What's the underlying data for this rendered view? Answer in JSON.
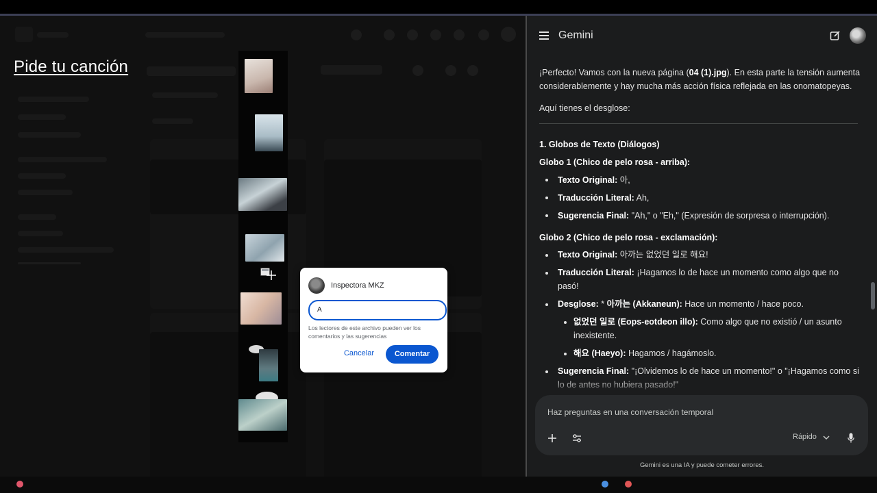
{
  "overlay": {
    "title": "Pide tu canción"
  },
  "comment_dialog": {
    "user_name": "Inspectora MKZ",
    "input_value": "A",
    "note": "Los lectores de este archivo pueden ver los comentarios y las sugerencias",
    "cancel_label": "Cancelar",
    "submit_label": "Comentar"
  },
  "gemini": {
    "title": "Gemini",
    "intro_1": "¡Perfecto! Vamos con la nueva página (",
    "intro_file": "04 (1).jpg",
    "intro_2": "). En esta parte la tensión aumenta considerablemente y hay mucha más acción física reflejada en las onomatopeyas.",
    "breakdown_intro": "Aquí tienes el desglose:",
    "section_heading": "1. Globos de Texto (Diálogos)",
    "globo1": {
      "heading": "Globo 1 (Chico de pelo rosa - arriba):",
      "original_label": "Texto Original:",
      "original_value": " 아,",
      "literal_label": "Traducción Literal:",
      "literal_value": " Ah,",
      "final_label": "Sugerencia Final:",
      "final_value": " \"Ah,\" o \"Eh,\" (Expresión de sorpresa o interrupción)."
    },
    "globo2": {
      "heading": "Globo 2 (Chico de pelo rosa - exclamación):",
      "original_label": "Texto Original:",
      "original_value": " 아까는 없었던 일로 해요!",
      "literal_label": "Traducción Literal:",
      "literal_value": " ¡Hagamos lo de hace un momento como algo que no pasó!",
      "desglose_label": "Desglose:",
      "desglose_star": " * ",
      "desglose_term": "아까는 (Akkaneun):",
      "desglose_value": " Hace un momento / hace poco.",
      "sub1_term": "없었던 일로 (Eops-eotdeon illo):",
      "sub1_value": " Como algo que no existió / un asunto inexistente.",
      "sub2_term": "해요 (Haeyo):",
      "sub2_value": " Hagamos / hagámoslo.",
      "final_label": "Sugerencia Final:",
      "final_value": " \"¡Olvidemos lo de hace un momento!\" o \"¡Hagamos como si lo de antes no hubiera pasado!\""
    },
    "composer": {
      "placeholder": "Haz preguntas en una conversación temporal",
      "model_label": "Rápido"
    },
    "disclaimer": "Gemini es una IA y puede cometer errores."
  }
}
